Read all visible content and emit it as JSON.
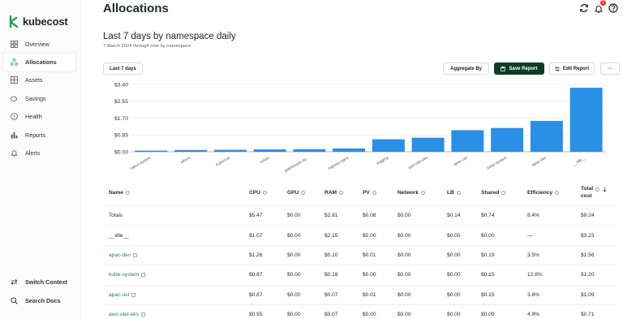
{
  "app": {
    "name": "kubecost"
  },
  "sidebar": {
    "items": [
      {
        "label": "Overview",
        "icon": "grid-icon"
      },
      {
        "label": "Allocations",
        "icon": "allocations-icon",
        "active": true
      },
      {
        "label": "Assets",
        "icon": "assets-icon"
      },
      {
        "label": "Savings",
        "icon": "piggy-bank-icon"
      },
      {
        "label": "Health",
        "icon": "health-icon"
      },
      {
        "label": "Reports",
        "icon": "bar-chart-icon"
      },
      {
        "label": "Alerts",
        "icon": "bell-icon"
      }
    ],
    "bottom": [
      {
        "label": "Switch Context",
        "icon": "switch-icon"
      },
      {
        "label": "Search Docs",
        "icon": "search-icon"
      }
    ]
  },
  "header": {
    "title": "Allocations",
    "notification_count": "2"
  },
  "report": {
    "title": "Last 7 days by namespace daily",
    "subtitle": "7 March 2024 through now by namespace"
  },
  "toolbar": {
    "date_range": "Last 7 days",
    "aggregate_by": "Aggregate By",
    "save_report": "Save Report",
    "edit_report": "Edit Report",
    "more": "···"
  },
  "chart_data": {
    "type": "bar",
    "categories": [
      "calico-system",
      "others",
      "kubecost",
      "velero",
      "gatekeeper-sy...",
      "ingress-nginx",
      "logging",
      "aws-otel-eks",
      "apac-ust",
      "kube-system",
      "apac-dev",
      "__idle__"
    ],
    "values": [
      0.06,
      0.09,
      0.1,
      0.12,
      0.13,
      0.17,
      0.63,
      0.71,
      1.09,
      1.2,
      1.56,
      3.23
    ],
    "ylim": [
      0,
      3.4
    ],
    "yticks": [
      "$3.40",
      "$2.55",
      "$1.70",
      "$0.85",
      "$0.00"
    ],
    "ytick_values": [
      3.4,
      2.55,
      1.7,
      0.85,
      0
    ],
    "grid": true,
    "color": "#2b8fe8"
  },
  "table": {
    "headers": {
      "name": "Name",
      "cpu": "CPU",
      "gpu": "GPU",
      "ram": "RAM",
      "pv": "PV",
      "network": "Network",
      "lb": "LB",
      "shared": "Shared",
      "efficiency": "Efficiency",
      "total_line1": "Total",
      "total_line2": "cost"
    },
    "rows": [
      {
        "name": "Totals",
        "link": false,
        "cpu": "$5.47",
        "gpu": "$0.00",
        "ram": "$2.81",
        "pv": "$0.08",
        "network": "$0.00",
        "lb": "$0.14",
        "shared": "$0.74",
        "efficiency": "8.4%",
        "total": "$9.24"
      },
      {
        "name": "__idle__",
        "link": false,
        "cpu": "$1.07",
        "gpu": "$0.00",
        "ram": "$2.15",
        "pv": "$0.00",
        "network": "$0.00",
        "lb": "$0.00",
        "shared": "$0.00",
        "efficiency": "—",
        "total": "$3.23"
      },
      {
        "name": "apac-dev",
        "link": true,
        "cpu": "$1.26",
        "gpu": "$0.00",
        "ram": "$0.10",
        "pv": "$0.01",
        "network": "$0.00",
        "lb": "$0.00",
        "shared": "$0.19",
        "efficiency": "3.5%",
        "total": "$1.56"
      },
      {
        "name": "kube-system",
        "link": true,
        "cpu": "$0.87",
        "gpu": "$0.00",
        "ram": "$0.18",
        "pv": "$0.00",
        "network": "$0.00",
        "lb": "$0.00",
        "shared": "$0.15",
        "efficiency": "12.8%",
        "total": "$1.20"
      },
      {
        "name": "apac-ust",
        "link": true,
        "cpu": "$0.87",
        "gpu": "$0.00",
        "ram": "$0.07",
        "pv": "$0.01",
        "network": "$0.00",
        "lb": "$0.00",
        "shared": "$0.15",
        "efficiency": "3.8%",
        "total": "$1.09"
      },
      {
        "name": "aws-otel-eks",
        "link": true,
        "cpu": "$0.55",
        "gpu": "$0.00",
        "ram": "$0.07",
        "pv": "$0.00",
        "network": "$0.00",
        "lb": "$0.00",
        "shared": "$0.09",
        "efficiency": "4.9%",
        "total": "$0.71"
      }
    ]
  }
}
